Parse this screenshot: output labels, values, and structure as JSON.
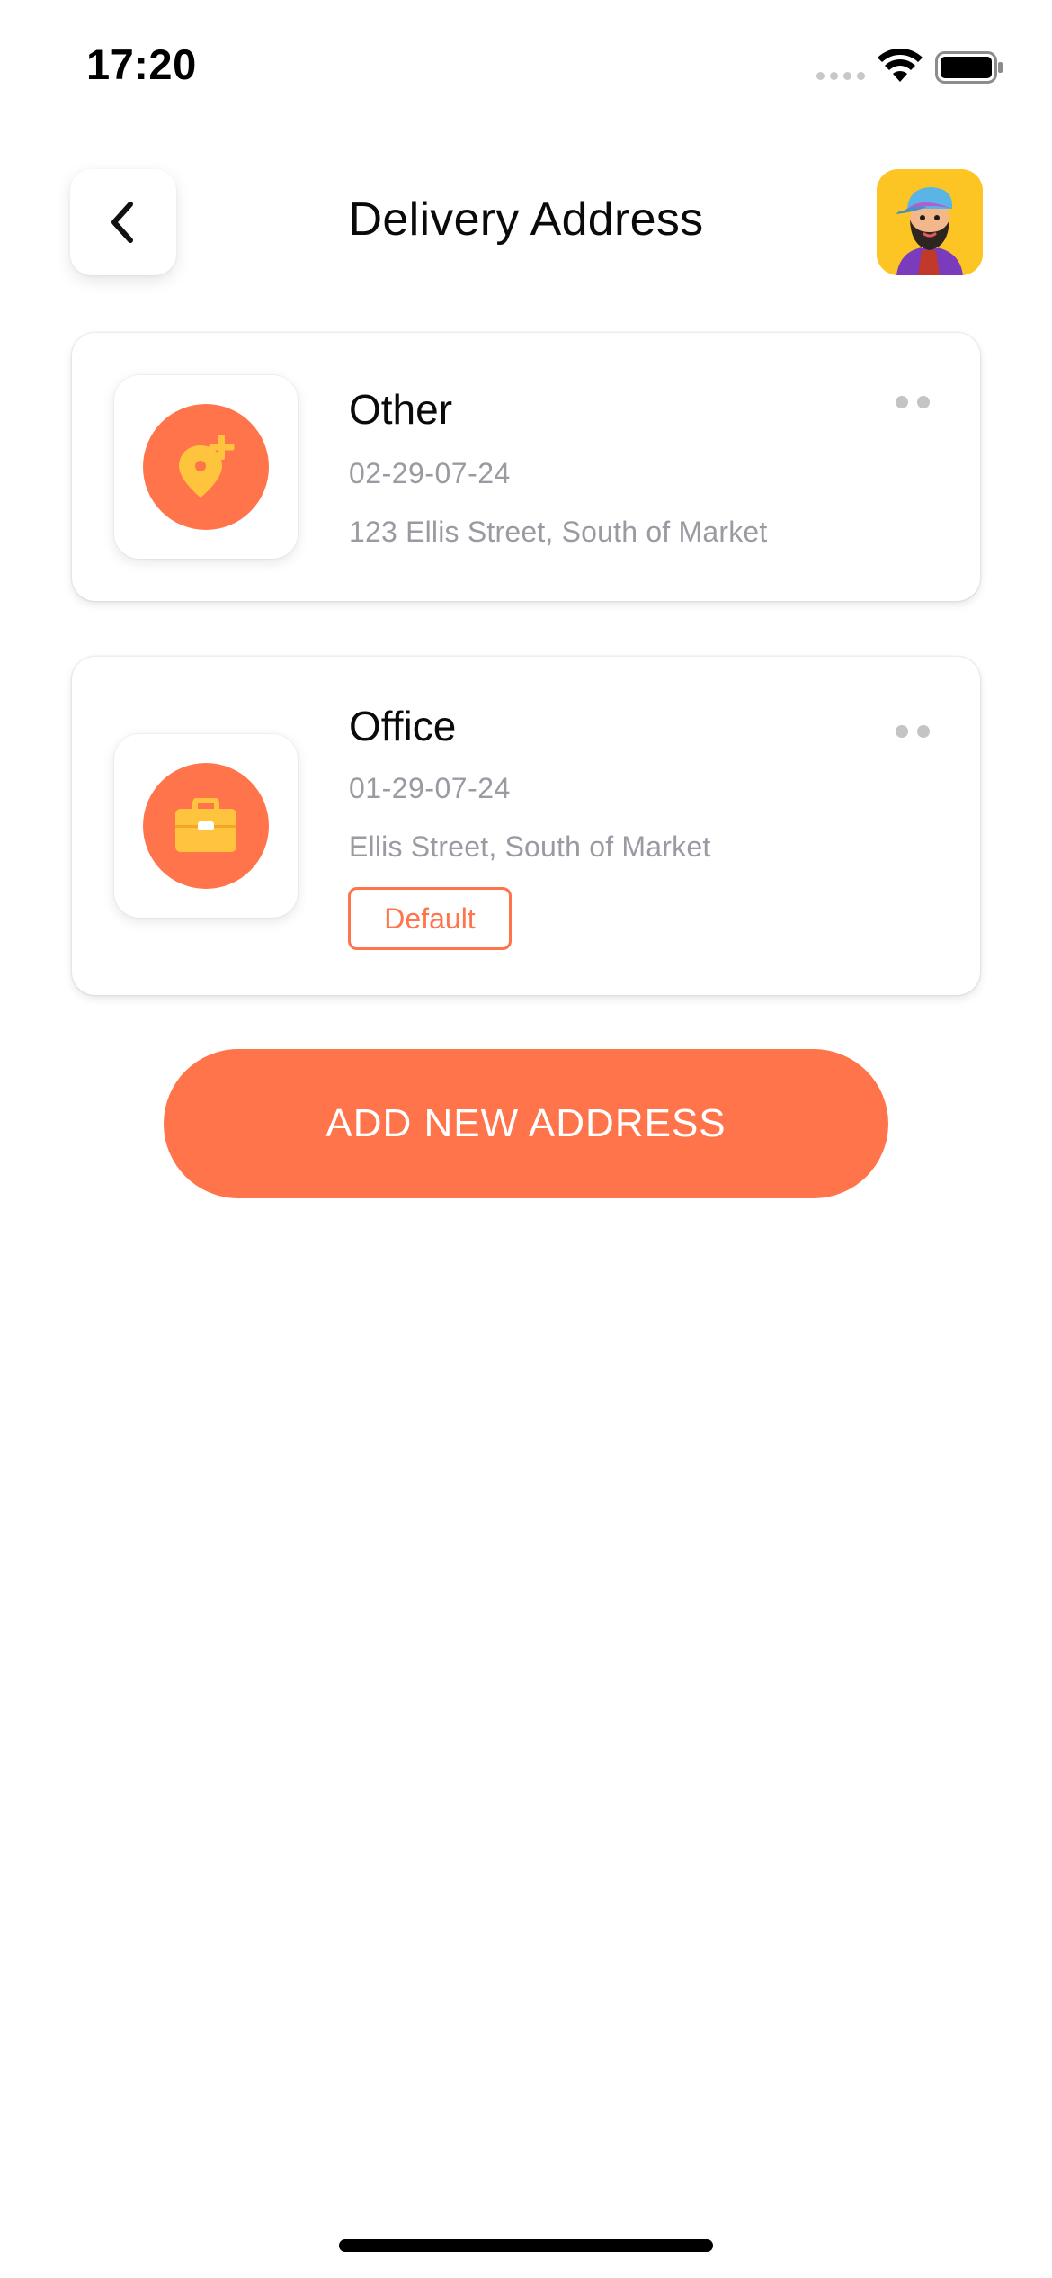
{
  "status_bar": {
    "time": "17:20"
  },
  "header": {
    "title": "Delivery Address",
    "back_icon": "chevron-left-icon",
    "avatar_icon": "bearded-man-avatar"
  },
  "addresses": [
    {
      "name": "Other",
      "code": "02-29-07-24",
      "street": "123 Ellis Street, South of Market",
      "icon": "location-pin-add-icon",
      "is_default": false
    },
    {
      "name": "Office",
      "code": "01-29-07-24",
      "street": "Ellis Street, South of Market",
      "icon": "briefcase-icon",
      "is_default": true,
      "badge": "Default"
    }
  ],
  "actions": {
    "add_new_label": "ADD NEW ADDRESS"
  },
  "colors": {
    "accent": "#ff744b",
    "icon_yellow": "#ffc43d",
    "muted_text": "#9a9aa3"
  }
}
